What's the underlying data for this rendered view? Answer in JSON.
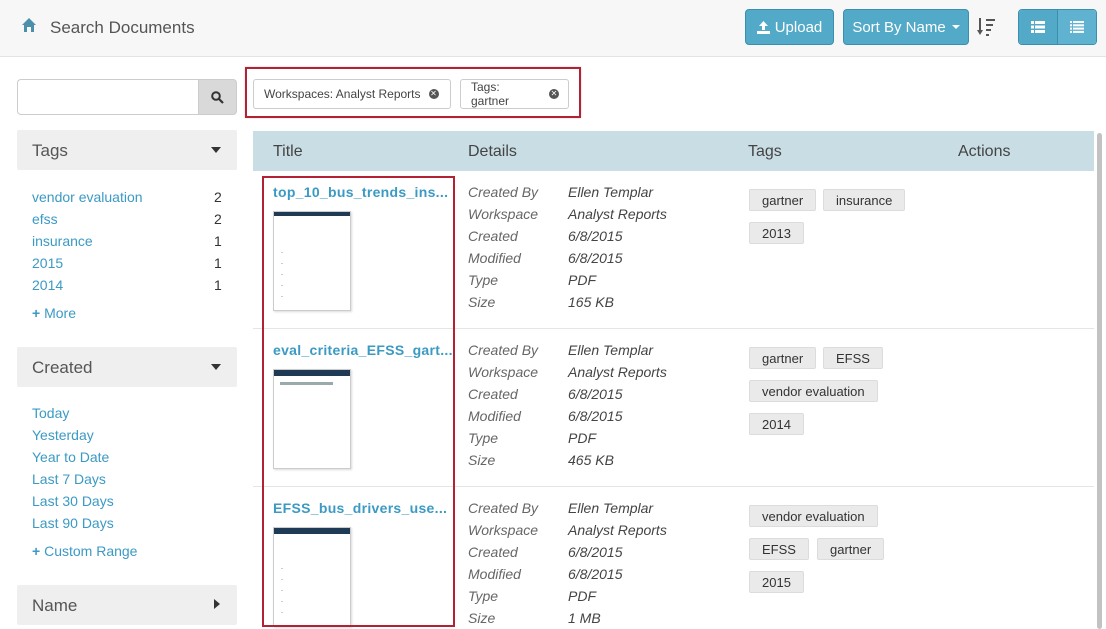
{
  "header": {
    "title": "Search Documents",
    "upload_label": "Upload",
    "sort_label": "Sort By Name",
    "colors": {
      "primary_button": "#52a9c8",
      "link": "#3b9ac4",
      "highlight_border": "#b22234"
    }
  },
  "search": {
    "value": "",
    "placeholder": ""
  },
  "facets": {
    "tags": {
      "heading": "Tags",
      "items": [
        {
          "label": "vendor evaluation",
          "count": "2"
        },
        {
          "label": "efss",
          "count": "2"
        },
        {
          "label": "insurance",
          "count": "1"
        },
        {
          "label": "2015",
          "count": "1"
        },
        {
          "label": "2014",
          "count": "1"
        }
      ],
      "more_label": "More"
    },
    "created": {
      "heading": "Created",
      "items": [
        "Today",
        "Yesterday",
        "Year to Date",
        "Last 7 Days",
        "Last 30 Days",
        "Last 90 Days"
      ],
      "custom_label": "Custom Range"
    },
    "name": {
      "heading": "Name"
    }
  },
  "filters": [
    {
      "label": "Workspaces: Analyst Reports"
    },
    {
      "label": "Tags: gartner"
    }
  ],
  "table": {
    "headers": {
      "title": "Title",
      "details": "Details",
      "tags": "Tags",
      "actions": "Actions"
    },
    "detail_labels": {
      "created_by": "Created By",
      "workspace": "Workspace",
      "created": "Created",
      "modified": "Modified",
      "type": "Type",
      "size": "Size"
    },
    "rows": [
      {
        "title": "top_10_bus_trends_ins...",
        "created_by": "Ellen Templar",
        "workspace": "Analyst Reports",
        "created": "6/8/2015",
        "modified": "6/8/2015",
        "type": "PDF",
        "size": "165 KB",
        "tags": [
          "gartner",
          "insurance",
          "2013"
        ]
      },
      {
        "title": "eval_criteria_EFSS_gart...",
        "created_by": "Ellen Templar",
        "workspace": "Analyst Reports",
        "created": "6/8/2015",
        "modified": "6/8/2015",
        "type": "PDF",
        "size": "465 KB",
        "tags": [
          "gartner",
          "EFSS",
          "vendor evaluation",
          "2014"
        ]
      },
      {
        "title": "EFSS_bus_drivers_use...",
        "created_by": "Ellen Templar",
        "workspace": "Analyst Reports",
        "created": "6/8/2015",
        "modified": "6/8/2015",
        "type": "PDF",
        "size": "1 MB",
        "tags": [
          "vendor evaluation",
          "EFSS",
          "gartner",
          "2015"
        ]
      }
    ]
  }
}
